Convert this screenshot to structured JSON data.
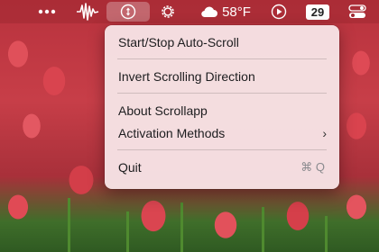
{
  "menubar": {
    "more_icon": "ellipsis-icon",
    "waveform_icon": "waveform-icon",
    "scroll_icon": "scroll-up-down-icon",
    "settings_icon": "gear-icon",
    "weather": {
      "icon": "cloud-icon",
      "temperature": "58°F"
    },
    "media_icon": "play-icon",
    "date_badge": "29",
    "control_center_icon": "toggles-icon"
  },
  "menu": {
    "start_stop": "Start/Stop Auto-Scroll",
    "invert": "Invert Scrolling Direction",
    "about": "About Scrollapp",
    "activation": "Activation Methods",
    "activation_chevron": "›",
    "quit": "Quit",
    "quit_shortcut": "⌘ Q"
  },
  "colors": {
    "menu_background": "#f6e2e4",
    "menubar_tint": "#a02832",
    "wallpaper_red": "#c23a44"
  }
}
